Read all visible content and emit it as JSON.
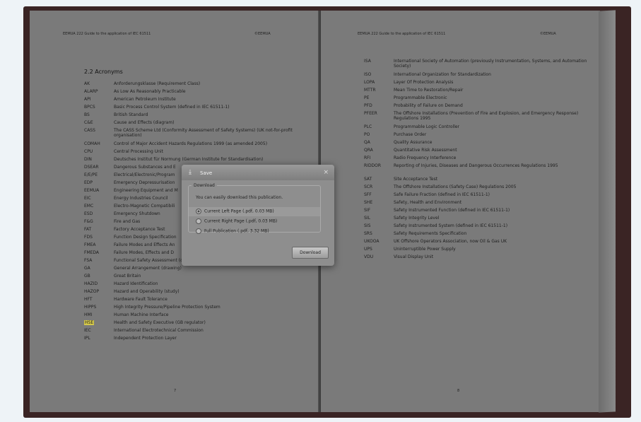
{
  "left_page": {
    "header_left": "EEMUA 222 Guide to the application of IEC 61511",
    "header_right": "©EEMUA",
    "section_title": "2.2  Acronyms",
    "rows": [
      {
        "abbr": "AK",
        "def": "Anforderungsklasse (Requirement Class)"
      },
      {
        "abbr": "ALARP",
        "def": "As Low As Reasonably Practicable"
      },
      {
        "abbr": "API",
        "def": "American Petroleum Institute"
      },
      {
        "abbr": "BPCS",
        "def": "Basic Process Control System (defined in IEC 61511-1)"
      },
      {
        "abbr": "BS",
        "def": "British Standard"
      },
      {
        "abbr": "C&E",
        "def": "Cause and Effects (diagram)"
      },
      {
        "abbr": "CASS",
        "def": "The CASS Scheme Ltd (Conformity Assessment of Safety Systems) (UK not-for-profit organisation)"
      },
      {
        "abbr": "COMAH",
        "def": "Control of Major Accident Hazards Regulations 1999 (as amended 2005)"
      },
      {
        "abbr": "CPU",
        "def": "Central Processing Unit"
      },
      {
        "abbr": "DIN",
        "def": "Deutsches Institut für Normung (German Institute for Standardisation)"
      },
      {
        "abbr": "DSEAR",
        "def": "Dangerous Substances and E"
      },
      {
        "abbr": "E/E/PE",
        "def": "Electrical/Electronic/Program"
      },
      {
        "abbr": "EDP",
        "def": "Emergency Depressurisation"
      },
      {
        "abbr": "EEMUA",
        "def": "Engineering Equipment and M"
      },
      {
        "abbr": "EIC",
        "def": "Energy Industries Council"
      },
      {
        "abbr": "EMC",
        "def": "Electro-Magnetic Compatibili"
      },
      {
        "abbr": "ESD",
        "def": "Emergency Shutdown"
      },
      {
        "abbr": "F&G",
        "def": "Fire and Gas"
      },
      {
        "abbr": "FAT",
        "def": "Factory Acceptance Test"
      },
      {
        "abbr": "FDS",
        "def": "Function Design Specification"
      },
      {
        "abbr": "FMEA",
        "def": "Failure Modes and Effects An"
      },
      {
        "abbr": "FMEDA",
        "def": "Failure Modes, Effects and D"
      },
      {
        "abbr": "FSA",
        "def": "Functional Safety Assessment (defined in IEC 61511-1)"
      },
      {
        "abbr": "GA",
        "def": "General Arrangement (drawing)"
      },
      {
        "abbr": "GB",
        "def": "Great Britain"
      },
      {
        "abbr": "HAZID",
        "def": "Hazard Identification"
      },
      {
        "abbr": "HAZOP",
        "def": "Hazard and Operability (study)"
      },
      {
        "abbr": "HFT",
        "def": "Hardware Fault Tolerance"
      },
      {
        "abbr": "HIPPS",
        "def": "High Integrity Pressure/Pipeline Protection System"
      },
      {
        "abbr": "HMI",
        "def": "Human Machine Interface"
      },
      {
        "abbr": "HSE",
        "def": "Health and Safety Executive (GB regulator)"
      },
      {
        "abbr": "IEC",
        "def": "International Electrotechnical Commission"
      },
      {
        "abbr": "IPL",
        "def": "Independent Protection Layer"
      }
    ],
    "page_number": "7"
  },
  "right_page": {
    "header_left": "EEMUA 222 Guide to the application of IEC 61511",
    "header_right": "©EEMUA",
    "rows": [
      {
        "abbr": "ISA",
        "def": "International Society of Automation (previously Instrumentation, Systems, and Automation Society)"
      },
      {
        "abbr": "ISO",
        "def": "International Organization for Standardization"
      },
      {
        "abbr": "LOPA",
        "def": "Layer Of Protection Analysis"
      },
      {
        "abbr": "MTTR",
        "def": "Mean Time to Restoration/Repair"
      },
      {
        "abbr": "PE",
        "def": "Programmable Electronic"
      },
      {
        "abbr": "PFD",
        "def": "Probability of Failure on Demand"
      },
      {
        "abbr": "PFEER",
        "def": "The Offshore Installations (Prevention of Fire and Explosion, and Emergency Response) Regulations 1995"
      },
      {
        "abbr": "PLC",
        "def": "Programmable Logic Controller"
      },
      {
        "abbr": "PO",
        "def": "Purchase Order"
      },
      {
        "abbr": "QA",
        "def": "Quality Assurance"
      },
      {
        "abbr": "QRA",
        "def": "Quantitative Risk Assessment"
      },
      {
        "abbr": "RFI",
        "def": "Radio Frequency Interference"
      },
      {
        "abbr": "RIDDOR",
        "def": "Reporting of Injuries, Diseases and Dangerous Occurrences Regulations 1995"
      },
      {
        "abbr": "SAT",
        "def": "Site Acceptance Test"
      },
      {
        "abbr": "SCR",
        "def": "The Offshore Installations (Safety Case) Regulations 2005"
      },
      {
        "abbr": "SFF",
        "def": "Safe Failure Fraction (defined in IEC 61511-1)"
      },
      {
        "abbr": "SHE",
        "def": "Safety, Health and Environment"
      },
      {
        "abbr": "SIF",
        "def": "Safety Instrumented Function (defined in IEC 61511-1)"
      },
      {
        "abbr": "SIL",
        "def": "Safety Integrity Level"
      },
      {
        "abbr": "SIS",
        "def": "Safety Instrumented System (defined in IEC 61511-1)"
      },
      {
        "abbr": "SRS",
        "def": "Safety Requirements Specification"
      },
      {
        "abbr": "UKOOA",
        "def": "UK Offshore Operators Association, now Oil & Gas UK"
      },
      {
        "abbr": "UPS",
        "def": "Uninterruptible Power Supply"
      },
      {
        "abbr": "VDU",
        "def": "Visual Display Unit"
      }
    ],
    "page_number": "8"
  },
  "dialog": {
    "title": "Save",
    "close": "×",
    "group_label": "Download",
    "note": "You can easily download this publication.",
    "options": [
      {
        "label": "Current Left Page (.pdf, 0.03 MB)",
        "selected": true
      },
      {
        "label": "Current Right Page (.pdf, 0.03 MB)",
        "selected": false
      },
      {
        "label": "Full Publication (.pdf, 3.32 MB)",
        "selected": false
      }
    ],
    "download_button": "Download"
  },
  "highlight_abbr": "HSE",
  "colors": {
    "highlight": "#d4c84a",
    "overlay_page": "#7a7a7a",
    "cover": "#3a2424"
  }
}
